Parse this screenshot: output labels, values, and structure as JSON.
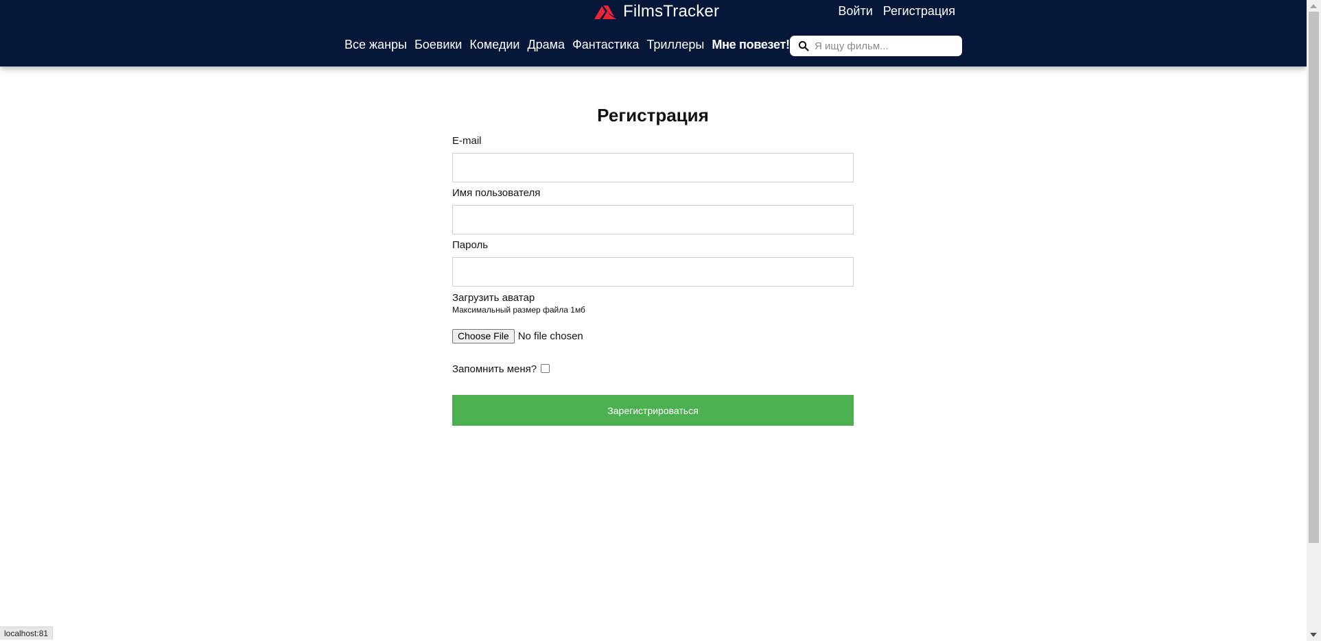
{
  "header": {
    "logo_text": "FilmsTracker",
    "colors": {
      "background": "#07173a",
      "logo_accent": "#e6273a"
    },
    "auth": {
      "login": "Войти",
      "register": "Регистрация"
    },
    "nav": [
      {
        "label": "Все жанры"
      },
      {
        "label": "Боевики"
      },
      {
        "label": "Комедии"
      },
      {
        "label": "Драма"
      },
      {
        "label": "Фантастика"
      },
      {
        "label": "Триллеры"
      },
      {
        "label": "Мне повезет!"
      }
    ],
    "search": {
      "placeholder": "Я ищу фильм...",
      "value": "",
      "icon": "search-icon"
    }
  },
  "form": {
    "title": "Регистрация",
    "email": {
      "label": "E-mail",
      "value": ""
    },
    "username": {
      "label": "Имя пользователя",
      "value": ""
    },
    "password": {
      "label": "Пароль",
      "value": ""
    },
    "avatar": {
      "label": "Загрузить аватар",
      "hint": "Максимальный размер файла 1мб",
      "button_label": "Choose File",
      "status": "No file chosen"
    },
    "remember": {
      "label": "Запомнить меня?",
      "checked": false
    },
    "submit_label": "Зарегистрироваться",
    "colors": {
      "submit": "#4caf50"
    }
  },
  "status_bar": {
    "url": "localhost:81"
  }
}
